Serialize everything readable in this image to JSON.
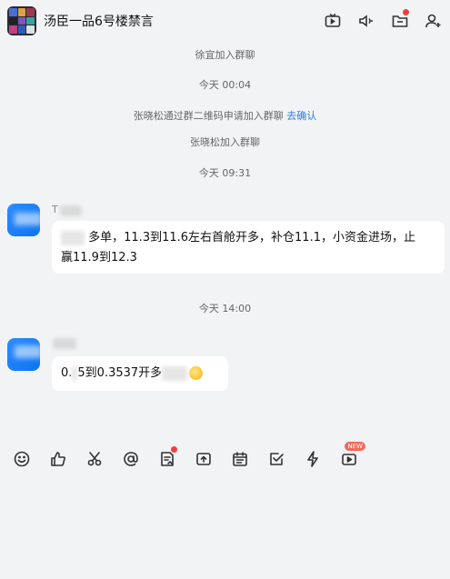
{
  "header": {
    "title": "汤臣一品6号楼禁言",
    "icons": [
      "tv-icon",
      "speaker-icon",
      "folder-icon",
      "add-user-icon"
    ],
    "folder_has_notification": true
  },
  "system_messages": [
    {
      "text": "徐宜加入群聊"
    },
    {
      "text": "今天 00:04"
    },
    {
      "text": "张晓松通过群二维码申请加入群聊",
      "link": "去确认"
    },
    {
      "text": "张晓松加入群聊"
    },
    {
      "text": "今天 09:31"
    },
    {
      "text": "今天 14:00"
    }
  ],
  "messages": [
    {
      "sender_visible": "T",
      "line1": "多单，11.3到11.6左右首舱开多，补仓11.1，小资金进场，止",
      "line2": "赢11.9到12.3"
    },
    {
      "prefix": "0.",
      "text": "5到0.3537开多"
    }
  ],
  "toolbar": {
    "items": [
      "emoji-icon",
      "like-icon",
      "scissors-icon",
      "at-icon",
      "note-icon",
      "upload-folder-icon",
      "calendar-icon",
      "checkbox-icon",
      "lightning-icon",
      "video-icon"
    ],
    "new_badge": "NEW"
  },
  "colors": {
    "background": "#f2f3f5",
    "accent": "#2b7de9",
    "badge_red": "#f03e3e"
  }
}
